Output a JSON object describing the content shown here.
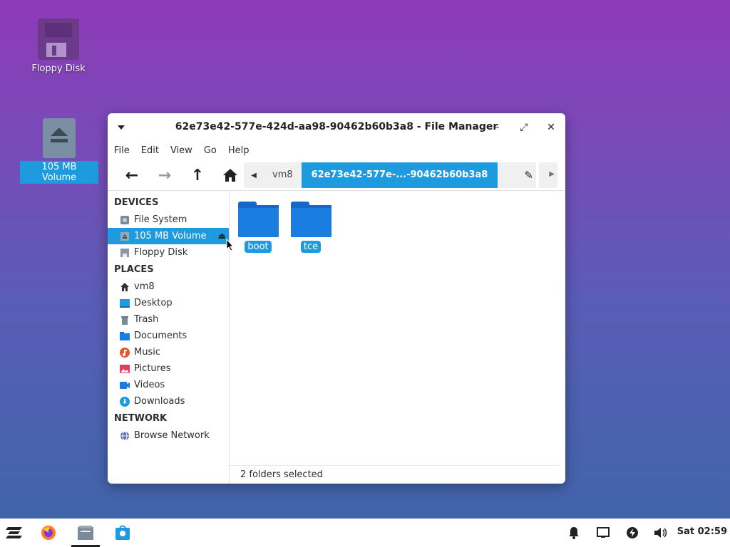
{
  "desktop": {
    "icons": [
      {
        "label": "Floppy Disk",
        "icon": "floppy-disk-icon"
      },
      {
        "label": "105 MB Volume",
        "icon": "drive-eject-icon",
        "selected": true
      }
    ]
  },
  "window": {
    "title": "62e73e42-577e-424d-aa98-90462b60b3a8 - File Manager",
    "controls": {
      "minimize": "–",
      "maximize": "⤢",
      "close": "✕"
    },
    "menu": [
      "File",
      "Edit",
      "View",
      "Go",
      "Help"
    ],
    "toolbar": {
      "back": "←",
      "forward": "→",
      "up": "↑",
      "home": "⌂"
    },
    "path": {
      "crumbs": [
        "vm8",
        "62e73e42-577e-...-90462b60b3a8"
      ],
      "active_index": 1
    },
    "sidebar": {
      "sections": [
        {
          "title": "DEVICES",
          "items": [
            {
              "label": "File System",
              "icon": "harddisk-icon"
            },
            {
              "label": "105 MB Volume",
              "icon": "drive-icon",
              "selected": true,
              "eject": "⏏"
            },
            {
              "label": "Floppy Disk",
              "icon": "floppy-icon"
            }
          ]
        },
        {
          "title": "PLACES",
          "items": [
            {
              "label": "vm8",
              "icon": "home-icon"
            },
            {
              "label": "Desktop",
              "icon": "desktop-icon"
            },
            {
              "label": "Trash",
              "icon": "trash-icon"
            },
            {
              "label": "Documents",
              "icon": "documents-icon"
            },
            {
              "label": "Music",
              "icon": "music-icon"
            },
            {
              "label": "Pictures",
              "icon": "pictures-icon"
            },
            {
              "label": "Videos",
              "icon": "videos-icon"
            },
            {
              "label": "Downloads",
              "icon": "downloads-icon"
            }
          ]
        },
        {
          "title": "NETWORK",
          "items": [
            {
              "label": "Browse Network",
              "icon": "network-icon"
            }
          ]
        }
      ]
    },
    "folders": [
      {
        "label": "boot"
      },
      {
        "label": "tce"
      }
    ],
    "status": "2 folders selected"
  },
  "taskbar": {
    "clock": "Sat 02:59"
  },
  "colors": {
    "accent": "#1e9bde",
    "folder": "#1a7ee0"
  }
}
